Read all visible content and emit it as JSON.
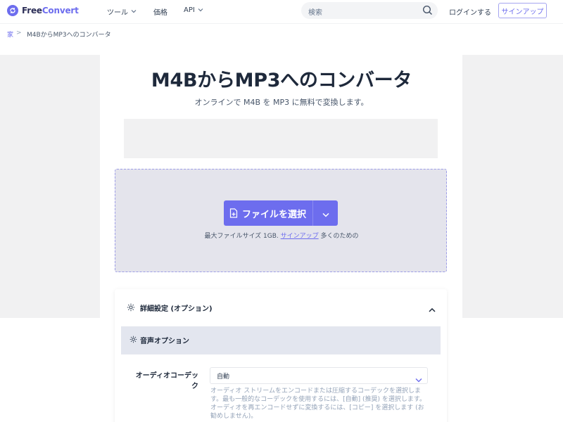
{
  "header": {
    "logo": {
      "prefix": "Free",
      "suffix": "Convert"
    },
    "nav": [
      {
        "label": "ツール",
        "has_dropdown": true
      },
      {
        "label": "価格",
        "has_dropdown": false
      },
      {
        "label": "API",
        "has_dropdown": true
      }
    ],
    "search": {
      "placeholder": "検索"
    },
    "login_label": "ログインする",
    "signup_label": "サインアップ"
  },
  "breadcrumb": {
    "home_icon": "家",
    "separator": ">",
    "current": "M4BからMP3へのコンバータ"
  },
  "main": {
    "title": "M4BからMP3へのコンバータ",
    "subtitle": "オンラインで M4B を MP3 に無料で変換します。"
  },
  "upload": {
    "choose_label": "ファイルを選択",
    "max_size_prefix": "最大ファイルサイズ 1GB.",
    "max_size_link": "サインアップ",
    "max_size_suffix": "多くのための"
  },
  "advanced": {
    "title": "詳細設定 (オプション)",
    "audio_section_title": "音声オプション",
    "codec_label": "オーディオコーデック",
    "codec_value": "自動",
    "codec_help": "オーディオ ストリームをエンコードまたは圧縮するコーデックを選択します。最も一般的なコーデックを使用するには、[自動] (推奨) を選択します。オーディオを再エンコードせずに変換するには、[コピー] を選択します (お勧めしません)。"
  },
  "colors": {
    "brand": "#6d6dee",
    "dropzone_bg": "#e4e4ec",
    "gray_band": "#f1f1f2",
    "text_dark": "#1e293b"
  },
  "icons": [
    "logo-icon",
    "chevron-down-icon",
    "search-icon",
    "home-icon",
    "file-plus-icon",
    "gear-icon",
    "chevron-up-icon"
  ]
}
